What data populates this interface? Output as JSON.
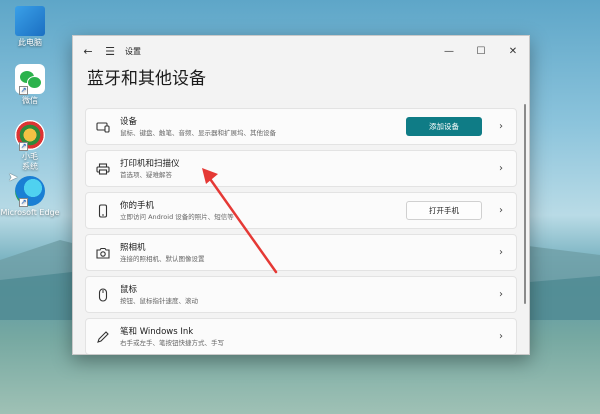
{
  "desktop": {
    "icons": [
      {
        "label": "此电脑",
        "icon": "computer-icon"
      },
      {
        "label": "微信",
        "icon": "wechat-icon"
      },
      {
        "label": "小毛\n系统",
        "icon": "helper-app-icon"
      },
      {
        "label": "Microsoft Edge",
        "icon": "edge-icon"
      }
    ]
  },
  "window": {
    "title": "设置",
    "page_title": "蓝牙和其他设备",
    "controls": {
      "back": "←",
      "menu": "☰",
      "minimize": "—",
      "maximize": "☐",
      "close": "✕"
    }
  },
  "cards": [
    {
      "name": "设备",
      "desc": "鼠标、键盘、触笔、音频、显示器和扩展坞、其他设备",
      "icon": "devices-icon",
      "button": "添加设备"
    },
    {
      "name": "打印机和扫描仪",
      "desc": "首选项、疑难解答",
      "icon": "printer-icon"
    },
    {
      "name": "你的手机",
      "desc": "立即访问 Android 设备的照片、短信等",
      "icon": "phone-icon",
      "button": "打开手机"
    },
    {
      "name": "照相机",
      "desc": "连接的照相机、默认图像设置",
      "icon": "camera-icon"
    },
    {
      "name": "鼠标",
      "desc": "按钮、鼠标指针速度、滚动",
      "icon": "mouse-icon"
    },
    {
      "name": "笔和 Windows Ink",
      "desc": "右手或左手、笔按钮快捷方式、手写",
      "icon": "pen-icon"
    }
  ],
  "colors": {
    "accent": "#0f7c86",
    "annotation": "#e53935"
  }
}
